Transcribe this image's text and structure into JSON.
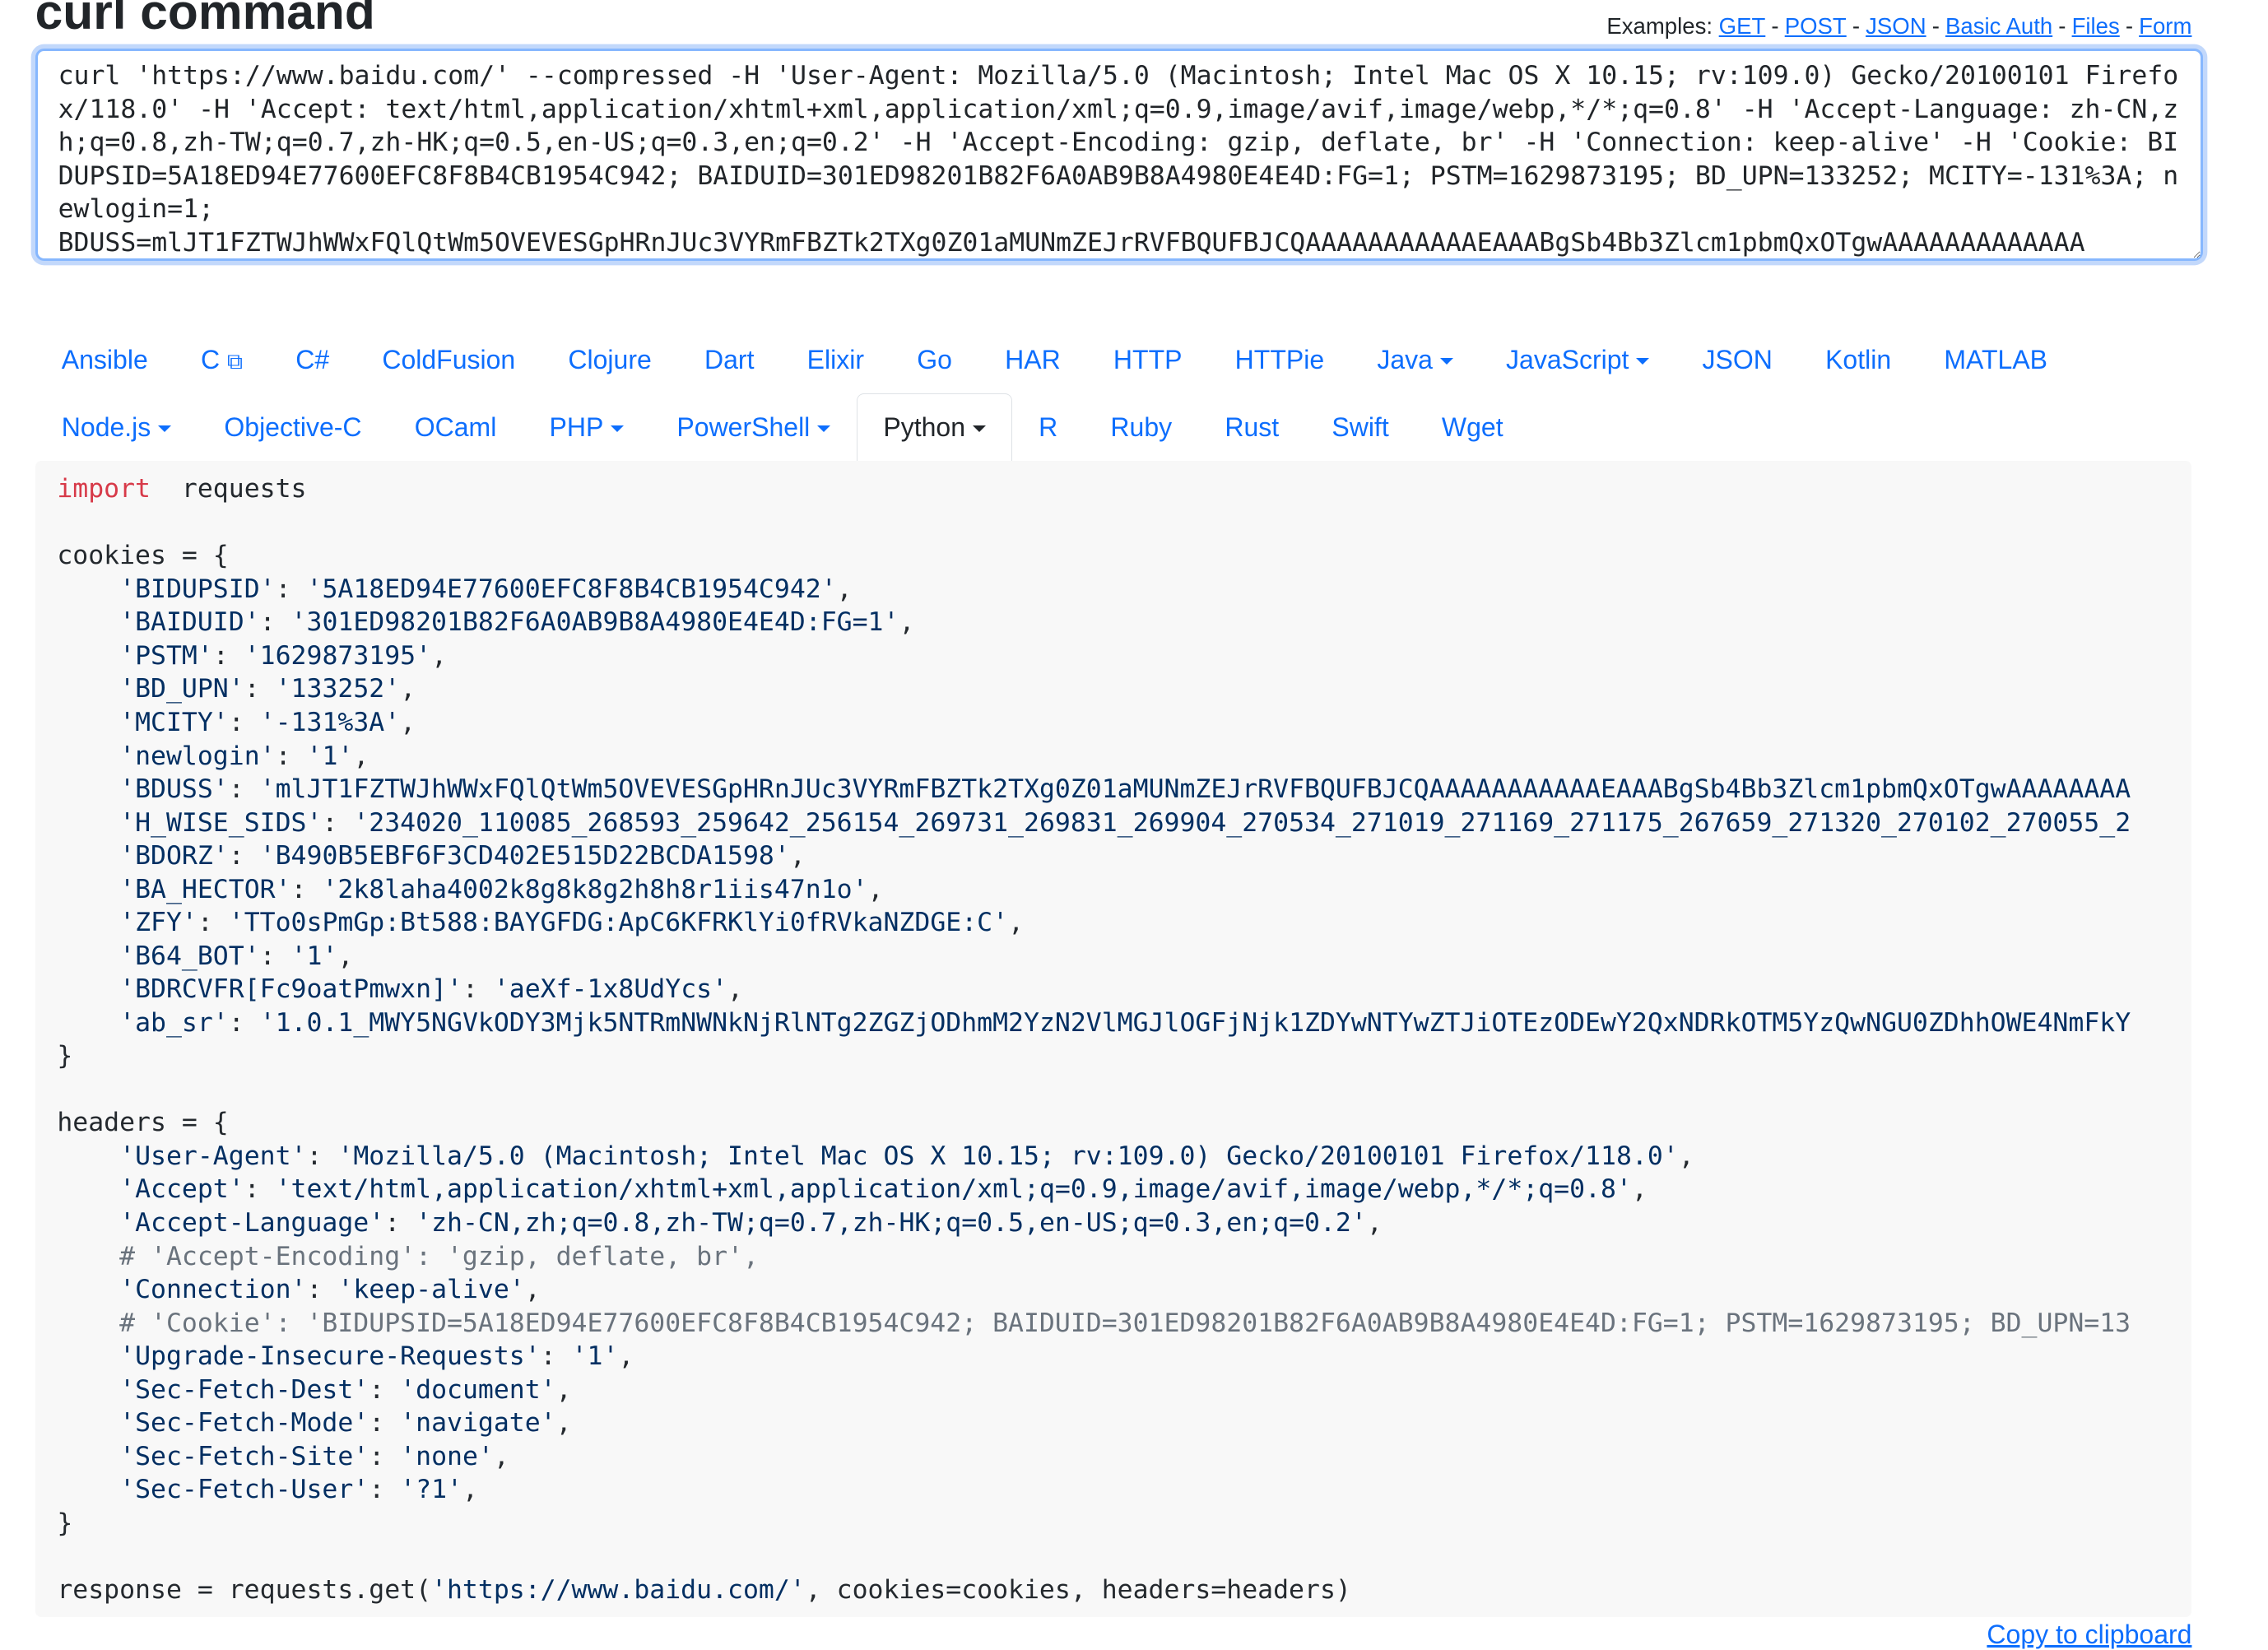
{
  "title": "curl command",
  "examples": {
    "label": "Examples:",
    "links": [
      "GET",
      "POST",
      "JSON",
      "Basic Auth",
      "Files",
      "Form"
    ],
    "separator": "-"
  },
  "curl_input": "curl 'https://www.baidu.com/' --compressed -H 'User-Agent: Mozilla/5.0 (Macintosh; Intel Mac OS X 10.15; rv:109.0) Gecko/20100101 Firefox/118.0' -H 'Accept: text/html,application/xhtml+xml,application/xml;q=0.9,image/avif,image/webp,*/*;q=0.8' -H 'Accept-Language: zh-CN,zh;q=0.8,zh-TW;q=0.7,zh-HK;q=0.5,en-US;q=0.3,en;q=0.2' -H 'Accept-Encoding: gzip, deflate, br' -H 'Connection: keep-alive' -H 'Cookie: BIDUPSID=5A18ED94E77600EFC8F8B4CB1954C942; BAIDUID=301ED98201B82F6A0AB9B8A4980E4E4D:FG=1; PSTM=1629873195; BD_UPN=133252; MCITY=-131%3A; newlogin=1;\nBDUSS=mlJT1FZTWJhWWxFQlQtWm5OVEVESGpHRnJUc3VYRmFBZTk2TXg0Z01aMUNmZEJrRVFBQUFBJCQAAAAAAAAAAAEAAABgSb4Bb3Zlcm1pbmQxOTgwAAAAAAAAAAAAA",
  "tabs": {
    "row1": [
      {
        "label": "Ansible"
      },
      {
        "label": "C",
        "icon": "external-link-icon"
      },
      {
        "label": "C#"
      },
      {
        "label": "ColdFusion"
      },
      {
        "label": "Clojure"
      },
      {
        "label": "Dart"
      },
      {
        "label": "Elixir"
      },
      {
        "label": "Go"
      },
      {
        "label": "HAR"
      },
      {
        "label": "HTTP"
      },
      {
        "label": "HTTPie"
      },
      {
        "label": "Java",
        "dropdown": true
      },
      {
        "label": "JavaScript",
        "dropdown": true
      },
      {
        "label": "JSON"
      },
      {
        "label": "Kotlin"
      },
      {
        "label": "MATLAB"
      }
    ],
    "row2": [
      {
        "label": "Node.js",
        "dropdown": true
      },
      {
        "label": "Objective-C"
      },
      {
        "label": "OCaml"
      },
      {
        "label": "PHP",
        "dropdown": true
      },
      {
        "label": "PowerShell",
        "dropdown": true
      },
      {
        "label": "Python",
        "dropdown": true,
        "active": true
      },
      {
        "label": "R"
      },
      {
        "label": "Ruby"
      },
      {
        "label": "Rust"
      },
      {
        "label": "Swift"
      },
      {
        "label": "Wget"
      }
    ]
  },
  "code_lines": [
    [
      [
        "kw",
        "import"
      ],
      [
        "",
        "  requests"
      ]
    ],
    [],
    [
      [
        "",
        "cookies = {"
      ]
    ],
    [
      [
        "",
        "    "
      ],
      [
        "str",
        "'BIDUPSID'"
      ],
      [
        "",
        ": "
      ],
      [
        "str",
        "'5A18ED94E77600EFC8F8B4CB1954C942'"
      ],
      [
        "",
        ","
      ]
    ],
    [
      [
        "",
        "    "
      ],
      [
        "str",
        "'BAIDUID'"
      ],
      [
        "",
        ": "
      ],
      [
        "str",
        "'301ED98201B82F6A0AB9B8A4980E4E4D:FG=1'"
      ],
      [
        "",
        ","
      ]
    ],
    [
      [
        "",
        "    "
      ],
      [
        "str",
        "'PSTM'"
      ],
      [
        "",
        ": "
      ],
      [
        "str",
        "'1629873195'"
      ],
      [
        "",
        ","
      ]
    ],
    [
      [
        "",
        "    "
      ],
      [
        "str",
        "'BD_UPN'"
      ],
      [
        "",
        ": "
      ],
      [
        "str",
        "'133252'"
      ],
      [
        "",
        ","
      ]
    ],
    [
      [
        "",
        "    "
      ],
      [
        "str",
        "'MCITY'"
      ],
      [
        "",
        ": "
      ],
      [
        "str",
        "'-131%3A'"
      ],
      [
        "",
        ","
      ]
    ],
    [
      [
        "",
        "    "
      ],
      [
        "str",
        "'newlogin'"
      ],
      [
        "",
        ": "
      ],
      [
        "str",
        "'1'"
      ],
      [
        "",
        ","
      ]
    ],
    [
      [
        "",
        "    "
      ],
      [
        "str",
        "'BDUSS'"
      ],
      [
        "",
        ": "
      ],
      [
        "str",
        "'mlJT1FZTWJhWWxFQlQtWm5OVEVESGpHRnJUc3VYRmFBZTk2TXg0Z01aMUNmZEJrRVFBQUFBJCQAAAAAAAAAAAEAAABgSb4Bb3Zlcm1pbmQxOTgwAAAAAAAA"
      ]
    ],
    [
      [
        "",
        "    "
      ],
      [
        "str",
        "'H_WISE_SIDS'"
      ],
      [
        "",
        ": "
      ],
      [
        "str",
        "'234020_110085_268593_259642_256154_269731_269831_269904_270534_271019_271169_271175_267659_271320_270102_270055_2"
      ]
    ],
    [
      [
        "",
        "    "
      ],
      [
        "str",
        "'BDORZ'"
      ],
      [
        "",
        ": "
      ],
      [
        "str",
        "'B490B5EBF6F3CD402E515D22BCDA1598'"
      ],
      [
        "",
        ","
      ]
    ],
    [
      [
        "",
        "    "
      ],
      [
        "str",
        "'BA_HECTOR'"
      ],
      [
        "",
        ": "
      ],
      [
        "str",
        "'2k8laha4002k8g8k8g2h8h8r1iis47n1o'"
      ],
      [
        "",
        ","
      ]
    ],
    [
      [
        "",
        "    "
      ],
      [
        "str",
        "'ZFY'"
      ],
      [
        "",
        ": "
      ],
      [
        "str",
        "'TTo0sPmGp:Bt588:BAYGFDG:ApC6KFRKlYi0fRVkaNZDGE:C'"
      ],
      [
        "",
        ","
      ]
    ],
    [
      [
        "",
        "    "
      ],
      [
        "str",
        "'B64_BOT'"
      ],
      [
        "",
        ": "
      ],
      [
        "str",
        "'1'"
      ],
      [
        "",
        ","
      ]
    ],
    [
      [
        "",
        "    "
      ],
      [
        "str",
        "'BDRCVFR[Fc9oatPmwxn]'"
      ],
      [
        "",
        ": "
      ],
      [
        "str",
        "'aeXf-1x8UdYcs'"
      ],
      [
        "",
        ","
      ]
    ],
    [
      [
        "",
        "    "
      ],
      [
        "str",
        "'ab_sr'"
      ],
      [
        "",
        ": "
      ],
      [
        "str",
        "'1.0.1_MWY5NGVkODY3Mjk5NTRmNWNkNjRlNTg2ZGZjODhmM2YzN2VlMGJlOGFjNjk1ZDYwNTYwZTJiOTEzODEwY2QxNDRkOTM5YzQwNGU0ZDhhOWE4NmFkY"
      ]
    ],
    [
      [
        "",
        "}"
      ]
    ],
    [],
    [
      [
        "",
        "headers = {"
      ]
    ],
    [
      [
        "",
        "    "
      ],
      [
        "str",
        "'User-Agent'"
      ],
      [
        "",
        ": "
      ],
      [
        "str",
        "'Mozilla/5.0 (Macintosh; Intel Mac OS X 10.15; rv:109.0) Gecko/20100101 Firefox/118.0'"
      ],
      [
        "",
        ","
      ]
    ],
    [
      [
        "",
        "    "
      ],
      [
        "str",
        "'Accept'"
      ],
      [
        "",
        ": "
      ],
      [
        "str",
        "'text/html,application/xhtml+xml,application/xml;q=0.9,image/avif,image/webp,*/*;q=0.8'"
      ],
      [
        "",
        ","
      ]
    ],
    [
      [
        "",
        "    "
      ],
      [
        "str",
        "'Accept-Language'"
      ],
      [
        "",
        ": "
      ],
      [
        "str",
        "'zh-CN,zh;q=0.8,zh-TW;q=0.7,zh-HK;q=0.5,en-US;q=0.3,en;q=0.2'"
      ],
      [
        "",
        ","
      ]
    ],
    [
      [
        "",
        "    "
      ],
      [
        "com",
        "# 'Accept-Encoding': 'gzip, deflate, br',"
      ]
    ],
    [
      [
        "",
        "    "
      ],
      [
        "str",
        "'Connection'"
      ],
      [
        "",
        ": "
      ],
      [
        "str",
        "'keep-alive'"
      ],
      [
        "",
        ","
      ]
    ],
    [
      [
        "",
        "    "
      ],
      [
        "com",
        "# 'Cookie': 'BIDUPSID=5A18ED94E77600EFC8F8B4CB1954C942; BAIDUID=301ED98201B82F6A0AB9B8A4980E4E4D:FG=1; PSTM=1629873195; BD_UPN=13"
      ]
    ],
    [
      [
        "",
        "    "
      ],
      [
        "str",
        "'Upgrade-Insecure-Requests'"
      ],
      [
        "",
        ": "
      ],
      [
        "str",
        "'1'"
      ],
      [
        "",
        ","
      ]
    ],
    [
      [
        "",
        "    "
      ],
      [
        "str",
        "'Sec-Fetch-Dest'"
      ],
      [
        "",
        ": "
      ],
      [
        "str",
        "'document'"
      ],
      [
        "",
        ","
      ]
    ],
    [
      [
        "",
        "    "
      ],
      [
        "str",
        "'Sec-Fetch-Mode'"
      ],
      [
        "",
        ": "
      ],
      [
        "str",
        "'navigate'"
      ],
      [
        "",
        ","
      ]
    ],
    [
      [
        "",
        "    "
      ],
      [
        "str",
        "'Sec-Fetch-Site'"
      ],
      [
        "",
        ": "
      ],
      [
        "str",
        "'none'"
      ],
      [
        "",
        ","
      ]
    ],
    [
      [
        "",
        "    "
      ],
      [
        "str",
        "'Sec-Fetch-User'"
      ],
      [
        "",
        ": "
      ],
      [
        "str",
        "'?1'"
      ],
      [
        "",
        ","
      ]
    ],
    [
      [
        "",
        "}"
      ]
    ],
    [],
    [
      [
        "",
        "response = requests.get("
      ],
      [
        "str",
        "'https://www.baidu.com/'"
      ],
      [
        "",
        ", cookies=cookies, headers=headers)"
      ]
    ]
  ],
  "copy_label": "Copy to clipboard",
  "colors": {
    "link": "#0d6efd",
    "keyword": "#d73a49",
    "string": "#032f62",
    "comment": "#6a737d",
    "code_bg": "#f8f8f8",
    "focus_border": "#86b7fe"
  }
}
